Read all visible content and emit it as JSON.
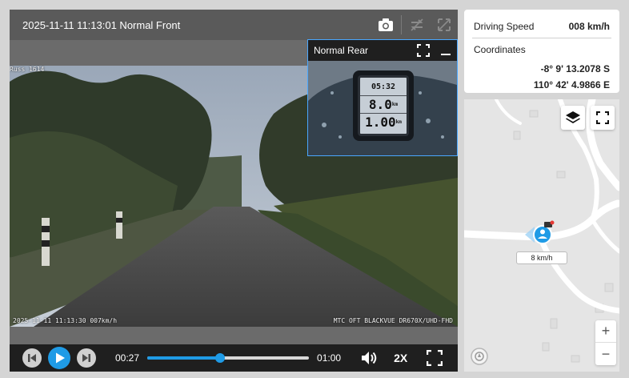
{
  "player": {
    "title": "2025-11-11 11:13:01 Normal Front",
    "osd_top": "Russ 1614",
    "osd_bottom_left": "2025-11-11 11:13:30 007km/h",
    "osd_bottom_right": "MTC OFT BLACKVUE DR670X/UHD-FHD",
    "rear": {
      "title": "Normal Rear",
      "gps_time": "05:32",
      "gps_distance": "8.0",
      "gps_distance_unit": "km",
      "gps_odometer": "1.00",
      "gps_odometer_unit": "km"
    },
    "controls": {
      "current_time": "00:27",
      "duration": "01:00",
      "progress": 0.45,
      "playback_speed": "2X"
    }
  },
  "info": {
    "speed_label": "Driving Speed",
    "speed_value": "008 km/h",
    "coordinates_label": "Coordinates",
    "latitude": "-8° 9' 13.2078 S",
    "longitude": "110° 42' 4.9866 E"
  },
  "map": {
    "vehicle_speed": "8 km/h",
    "zoom_in": "+",
    "zoom_out": "−"
  },
  "colors": {
    "accent": "#1f9be6",
    "header_bg": "#5a5a5a",
    "controls_bg": "#1f1f1f"
  }
}
